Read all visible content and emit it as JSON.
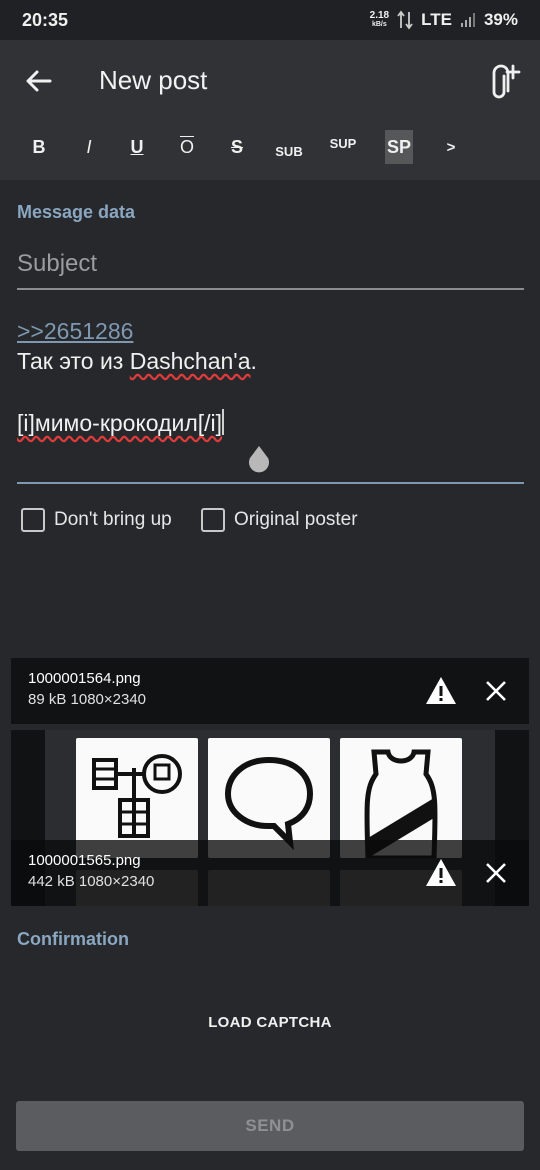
{
  "status_bar": {
    "time": "20:35",
    "data_rate": "2.18",
    "data_rate_unit": "kB/s",
    "network": "LTE",
    "battery": "39%"
  },
  "app_bar": {
    "title": "New post",
    "icons": {
      "back": "arrow-left",
      "attach": "paperclip-plus"
    }
  },
  "format_toolbar": {
    "bold": "B",
    "italic": "I",
    "underline": "U",
    "overline": "O",
    "strike": "S",
    "subscript": "SUB",
    "superscript": "SUP",
    "spoiler": "SP",
    "quote": ">"
  },
  "form": {
    "section_label": "Message data",
    "subject_placeholder": "Subject",
    "message": {
      "reply_link": ">>2651286",
      "line2_prefix": "Так это из ",
      "line2_word": "Dashchan'a",
      "line2_suffix": ".",
      "line4": "[i]мимо-крокодил[/i]"
    },
    "checkboxes": {
      "dont_bring_up": "Don't bring up",
      "original_poster": "Original poster"
    }
  },
  "attachments": [
    {
      "filename": "1000001564.png",
      "size": "89 kB",
      "dimensions": "1080×2340"
    },
    {
      "filename": "1000001565.png",
      "size": "442 kB",
      "dimensions": "1080×2340"
    }
  ],
  "confirmation": {
    "label": "Confirmation",
    "load_captcha": "LOAD CAPTCHA"
  },
  "send_button": "SEND",
  "colors": {
    "background": "#26282b",
    "app_bar": "#303236",
    "accent": "#8aa6c0",
    "spellcheck": "#e03a3a",
    "send_disabled": "#5a5c60"
  }
}
